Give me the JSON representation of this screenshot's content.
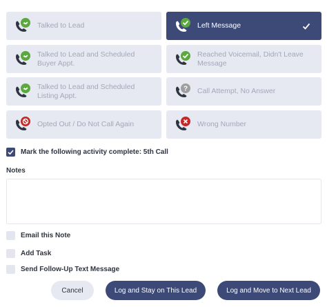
{
  "outcomes": [
    {
      "label": "Talked to Lead",
      "icon": "phone-talk-green-icon",
      "selected": false
    },
    {
      "label": "Left Message",
      "icon": "phone-check-green-icon",
      "selected": true
    },
    {
      "label": "Talked to Lead and Scheduled Buyer Appt.",
      "icon": "phone-talk-green-icon",
      "selected": false
    },
    {
      "label": "Reached Voicemail, Didn't Leave Message",
      "icon": "phone-check-green-icon",
      "selected": false
    },
    {
      "label": "Talked to Lead and Scheduled Listing Appt.",
      "icon": "phone-talk-green-icon",
      "selected": false
    },
    {
      "label": "Call Attempt, No Answer",
      "icon": "phone-question-gray-icon",
      "selected": false
    },
    {
      "label": "Opted Out / Do Not Call Again",
      "icon": "phone-block-red-icon",
      "selected": false
    },
    {
      "label": "Wrong Number",
      "icon": "phone-x-red-icon",
      "selected": false
    }
  ],
  "mark_complete": {
    "label": "Mark the following activity complete: 5th Call",
    "checked": true
  },
  "notes": {
    "label": "Notes",
    "value": "",
    "placeholder": ""
  },
  "options": {
    "email_note": {
      "label": "Email this Note",
      "checked": false
    },
    "add_task": {
      "label": "Add Task",
      "checked": false
    },
    "follow_up_text": {
      "label": "Send Follow-Up Text Message",
      "checked": false
    }
  },
  "buttons": {
    "cancel": "Cancel",
    "log_stay": "Log and Stay on This Lead",
    "log_next": "Log and Move to Next Lead"
  },
  "colors": {
    "primary": "#3d4a78",
    "card_bg": "#e6e9f2",
    "muted_text": "#a2a8b8",
    "green": "#4caf50",
    "red": "#c62828",
    "gray": "#9e9e9e"
  }
}
